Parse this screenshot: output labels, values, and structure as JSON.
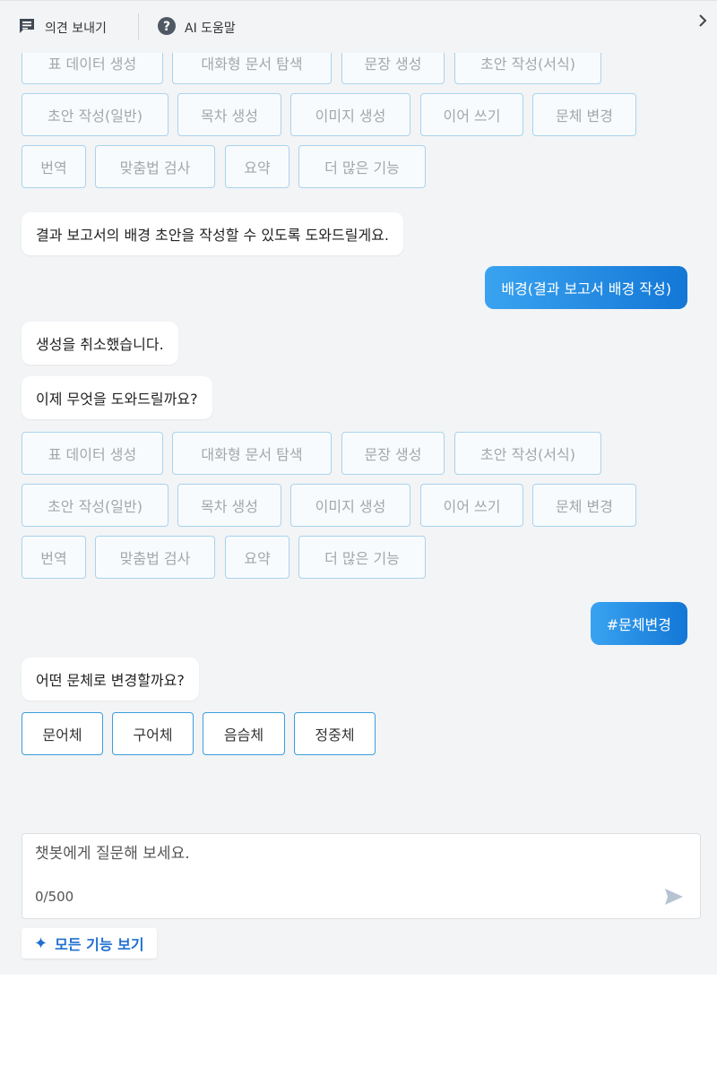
{
  "header": {
    "feedback_label": "의견 보내기",
    "help_label": "AI 도움말",
    "collapse_icon": "chevron-right-icon"
  },
  "menu1": {
    "row1": [
      "표 데이터 생성",
      "대화형 문서 탐색",
      "문장 생성",
      "초안 작성(서식)"
    ],
    "row2": [
      "초안 작성(일반)",
      "목차 생성",
      "이미지 생성",
      "이어 쓰기",
      "문체 변경"
    ],
    "row3": [
      "번역",
      "맞춤법 검사",
      "요약",
      "더 많은 기능"
    ]
  },
  "messages": {
    "bot_background": "결과 보고서의 배경 초안을 작성할 수 있도록 도와드릴게요.",
    "user_background": "배경(결과 보고서 배경 작성)",
    "bot_cancelled": "생성을 취소했습니다.",
    "bot_what_next": "이제 무엇을 도와드릴까요?",
    "user_style": "#문체변경",
    "bot_which_style": "어떤 문체로 변경할까요?"
  },
  "menu2": {
    "row1": [
      "표 데이터 생성",
      "대화형 문서 탐색",
      "문장 생성",
      "초안 작성(서식)"
    ],
    "row2": [
      "초안 작성(일반)",
      "목차 생성",
      "이미지 생성",
      "이어 쓰기",
      "문체 변경"
    ],
    "row3": [
      "번역",
      "맞춤법 검사",
      "요약",
      "더 많은 기능"
    ]
  },
  "style_options": [
    "문어체",
    "구어체",
    "음슴체",
    "정중체"
  ],
  "input": {
    "placeholder": "챗봇에게 질문해 보세요.",
    "value": "",
    "char_count": "0/500"
  },
  "all_features_label": "모든 기능 보기",
  "colors": {
    "accent": "#1f6fd0",
    "user_bubble_start": "#3aa3f0",
    "user_bubble_end": "#1377d6",
    "chip_border": "#a9d3ee",
    "panel_bg": "#f3f4f6"
  }
}
